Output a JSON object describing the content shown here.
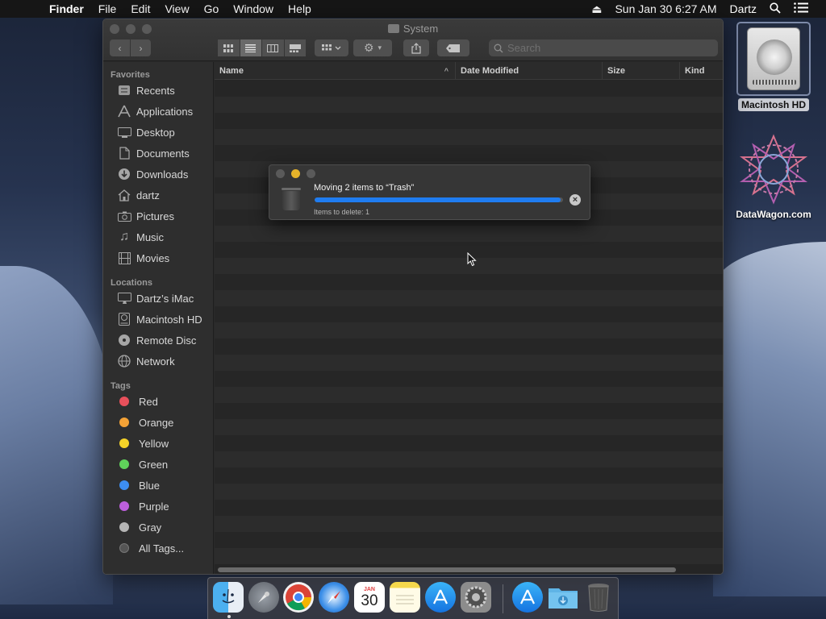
{
  "menubar": {
    "app_name": "Finder",
    "menus": [
      "File",
      "Edit",
      "View",
      "Go",
      "Window",
      "Help"
    ],
    "datetime": "Sun Jan 30  6:27 AM",
    "user": "Dartz"
  },
  "desktop": {
    "icons": [
      {
        "label": "Macintosh HD",
        "icon": "hard-drive-icon"
      },
      {
        "label": "DataWagon.com",
        "icon": "geometric-star-icon"
      }
    ]
  },
  "finder": {
    "title": "System",
    "search_placeholder": "Search",
    "columns": [
      "Name",
      "Date Modified",
      "Size",
      "Kind"
    ],
    "sidebar": {
      "favorites_heading": "Favorites",
      "favorites": [
        {
          "label": "Recents",
          "icon": "clock-icon"
        },
        {
          "label": "Applications",
          "icon": "applications-icon"
        },
        {
          "label": "Desktop",
          "icon": "desktop-icon"
        },
        {
          "label": "Documents",
          "icon": "document-icon"
        },
        {
          "label": "Downloads",
          "icon": "download-icon"
        },
        {
          "label": "dartz",
          "icon": "home-icon"
        },
        {
          "label": "Pictures",
          "icon": "camera-icon"
        },
        {
          "label": "Music",
          "icon": "music-note-icon"
        },
        {
          "label": "Movies",
          "icon": "film-icon"
        }
      ],
      "locations_heading": "Locations",
      "locations": [
        {
          "label": "Dartz’s iMac",
          "icon": "imac-icon"
        },
        {
          "label": "Macintosh HD",
          "icon": "hard-drive-icon"
        },
        {
          "label": "Remote Disc",
          "icon": "disc-icon"
        },
        {
          "label": "Network",
          "icon": "globe-icon"
        }
      ],
      "tags_heading": "Tags",
      "tags": [
        {
          "label": "Red",
          "color": "#e8505b"
        },
        {
          "label": "Orange",
          "color": "#f4a236"
        },
        {
          "label": "Yellow",
          "color": "#f5d328"
        },
        {
          "label": "Green",
          "color": "#5fd35a"
        },
        {
          "label": "Blue",
          "color": "#3d8ef2"
        },
        {
          "label": "Purple",
          "color": "#bd5fdc"
        },
        {
          "label": "Gray",
          "color": "#b5b5b5"
        },
        {
          "label": "All Tags...",
          "color": "#555555"
        }
      ]
    }
  },
  "progress_dialog": {
    "title": "Moving 2 items to “Trash”",
    "subtitle": "Items to delete: 1",
    "progress_fraction": 0.99,
    "accent": "#1f7cf0"
  },
  "dock": {
    "apps": [
      "finder-icon",
      "launchpad-icon",
      "chrome-icon",
      "safari-icon",
      "calendar-icon",
      "notes-icon",
      "app-store-icon",
      "system-preferences-icon",
      "app-store-folder-icon",
      "downloads-folder-icon",
      "trash-icon"
    ],
    "calendar_month": "JAN",
    "calendar_day": "30"
  }
}
